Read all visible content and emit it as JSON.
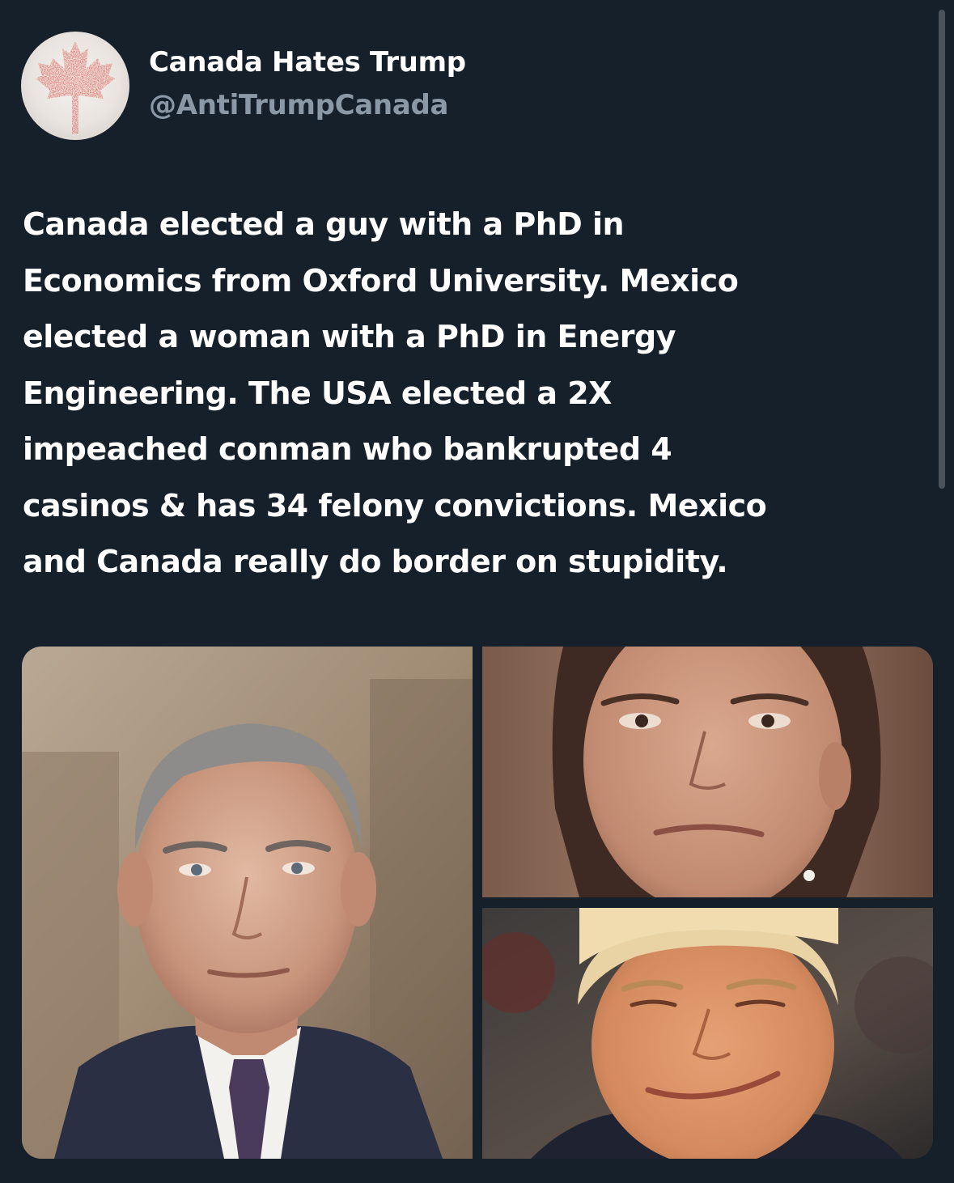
{
  "author": {
    "display_name": "Canada Hates Trump",
    "handle": "@AntiTrumpCanada",
    "avatar_icon": "maple-leaf-icon",
    "avatar_color": "#d52b1e"
  },
  "tweet": {
    "text": "Canada elected a guy with a PhD in\nEconomics from Oxford University. Mexico\nelected a woman with a PhD in Energy\nEngineering. The USA elected a 2X\nimpeached conman who bankrupted 4\ncasinos & has 34 felony convictions. Mexico\nand Canada really do border on stupidity."
  },
  "media": {
    "count": 3,
    "photos": [
      {
        "name": "photo-man-grey-hair-suit"
      },
      {
        "name": "photo-woman-close-up"
      },
      {
        "name": "photo-man-blond-hair-smirk"
      }
    ]
  },
  "colors": {
    "background": "#15202b",
    "primary_text": "#ffffff",
    "secondary_text": "#8b98a5"
  }
}
